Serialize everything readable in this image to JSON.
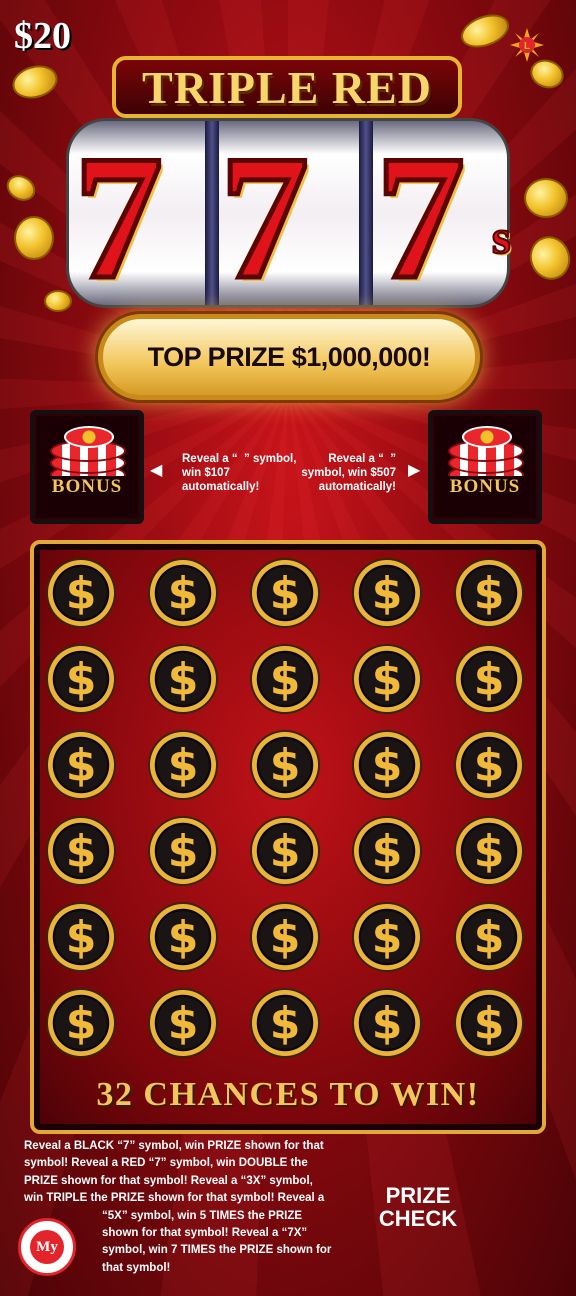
{
  "ticket": {
    "price": "$20",
    "title": "TRIPLE RED",
    "sevens": [
      "7",
      "7",
      "7"
    ],
    "sevens_suffix": "s",
    "top_prize": "TOP PRIZE $1,000,000!"
  },
  "bonus": {
    "label_left": "BONUS",
    "label_right": "BONUS",
    "text_left": "Reveal a “  ” symbol, win $107 automatically!",
    "text_right": "Reveal a “  ” symbol, win $507 automatically!"
  },
  "play_area": {
    "spot_symbol": "$",
    "rows": 6,
    "cols": 5,
    "headline": "32 CHANCES TO WIN!"
  },
  "rules_lines": [
    "Reveal a BLACK “7” symbol, win PRIZE shown for that",
    "symbol! Reveal a RED “7” symbol, win DOUBLE the",
    "PRIZE shown for that symbol! Reveal a “3X” symbol,",
    "win TRIPLE the PRIZE shown for that symbol! Reveal a",
    "“5X” symbol, win 5 TIMES the PRIZE",
    "shown for that symbol! Reveal a “7X”",
    "symbol, win 7 TIMES the PRIZE shown for",
    "that symbol!"
  ],
  "logo": {
    "arc_top": "LOTTERY",
    "center": "My",
    "arc_bottom": "REWARDS"
  },
  "prize_check": [
    "PRIZE",
    "CHECK"
  ],
  "colors": {
    "background_red": "#c8141a",
    "gold": "#f2c65a",
    "seven_red": "#e0121a"
  },
  "icons": [
    "dollar-coin-icon",
    "casino-chip-icon",
    "lottery-sun-icon",
    "gold-coin-icon"
  ]
}
